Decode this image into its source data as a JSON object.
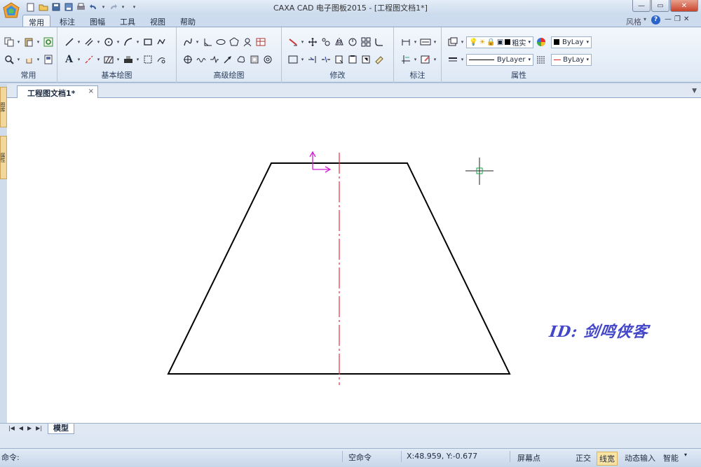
{
  "window": {
    "title": "CAXA CAD 电子图板2015 - [工程图文档1*]",
    "style_label": "风格",
    "help_symbol": "?"
  },
  "ribbon": {
    "tabs": [
      "常用",
      "标注",
      "图幅",
      "工具",
      "视图",
      "帮助"
    ],
    "active_tab": "常用",
    "groups": [
      "常用",
      "基本绘图",
      "高级绘图",
      "修改",
      "标注",
      "属性"
    ],
    "properties": {
      "line_type_label": "粗实",
      "color_value": "ByLay",
      "line_style_value": "ByLayer",
      "line_color_value": "ByLay"
    }
  },
  "document": {
    "tab_label": "工程图文档1*",
    "close_symbol": "×"
  },
  "sidebar": {
    "tabs": [
      "图库",
      "属性"
    ]
  },
  "canvas": {
    "watermark": "ID: 剑鸣侠客"
  },
  "sheets": {
    "model_tab": "模型"
  },
  "status": {
    "command_prompt": "命令:",
    "command_state": "空命令",
    "coordinates": "X:48.959, Y:-0.677",
    "snap_mode": "屏幕点",
    "ortho": "正交",
    "line_width": "线宽",
    "dynamic_input": "动态输入",
    "smart": "智能"
  },
  "colors": {
    "outline": "#000000",
    "centerline": "#e8304a",
    "ucs": "#d21fd1",
    "crosshair_box": "#13a84a",
    "watermark": "#4346c8"
  }
}
